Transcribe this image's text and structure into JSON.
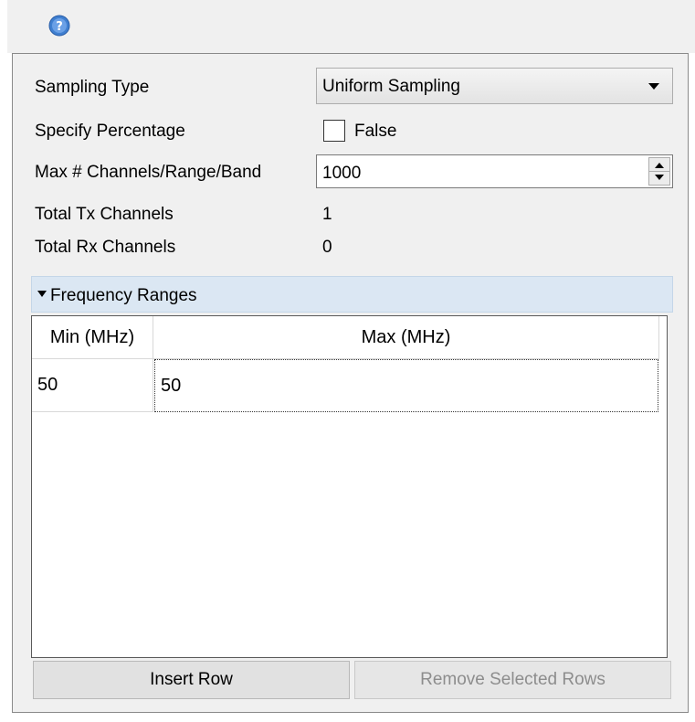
{
  "toolbar": {
    "help_icon": "help-icon"
  },
  "form": {
    "sampling_type_label": "Sampling Type",
    "sampling_type_value": "Uniform Sampling",
    "specify_percentage_label": "Specify Percentage",
    "specify_percentage_value": "False",
    "specify_percentage_checked": false,
    "max_channels_label": "Max # Channels/Range/Band",
    "max_channels_value": "1000",
    "total_tx_label": "Total Tx Channels",
    "total_tx_value": "1",
    "total_rx_label": "Total Rx Channels",
    "total_rx_value": "0"
  },
  "frequency_ranges": {
    "title": "Frequency Ranges",
    "columns": [
      "Min (MHz)",
      "Max (MHz)"
    ],
    "rows": [
      [
        "50",
        "50"
      ]
    ]
  },
  "buttons": {
    "insert_row": "Insert Row",
    "remove_selected_rows": "Remove Selected Rows"
  },
  "colors": {
    "panel_bg": "#f0f0f0",
    "section_header_bg": "#dbe7f3",
    "help_icon": "#3f7fd0"
  }
}
